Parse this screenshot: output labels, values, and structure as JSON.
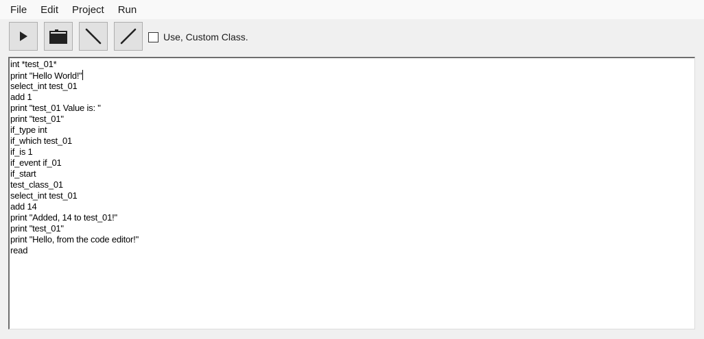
{
  "menu": {
    "items": [
      "File",
      "Edit",
      "Project",
      "Run"
    ]
  },
  "toolbar": {
    "buttons": [
      {
        "name": "run",
        "icon": "play-icon"
      },
      {
        "name": "open",
        "icon": "folder-icon"
      },
      {
        "name": "back-slash",
        "icon": "backslash-icon"
      },
      {
        "name": "forward-slash",
        "icon": "slash-icon"
      }
    ],
    "checkbox_label": "Use, Custom Class.",
    "checkbox_checked": false
  },
  "editor": {
    "lines": [
      "int *test_01*",
      "print \"Hello World!\"",
      "select_int test_01",
      "add 1",
      "print \"test_01 Value is: \"",
      "print \"test_01\"",
      "if_type int",
      "if_which test_01",
      "if_is 1",
      "if_event if_01",
      "if_start",
      "test_class_01",
      "select_int test_01",
      "add 14",
      "print \"Added, 14 to test_01!\"",
      "print \"test_01\"",
      "print \"Hello, from the code editor!\"",
      "read"
    ],
    "caret_line": 1
  }
}
